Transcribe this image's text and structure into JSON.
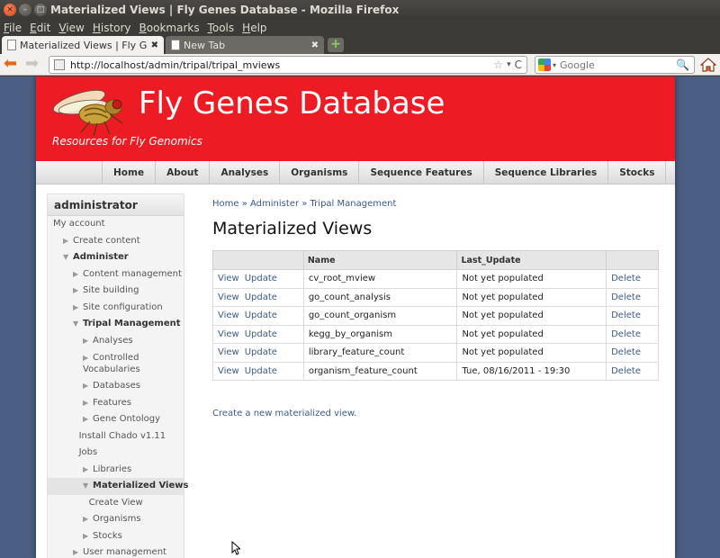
{
  "window": {
    "title": "Materialized Views | Fly Genes Database - Mozilla Firefox",
    "controls": {
      "close": "×",
      "minimize": "–",
      "maximize": "□"
    }
  },
  "menubar": [
    "File",
    "Edit",
    "View",
    "History",
    "Bookmarks",
    "Tools",
    "Help"
  ],
  "tabs": [
    {
      "label": "Materialized Views | Fly Ge...",
      "active": true,
      "close": "✖"
    },
    {
      "label": "New Tab",
      "active": false,
      "close": "✖"
    }
  ],
  "newtab_label": "+",
  "navbar": {
    "back": "⬅",
    "forward": "➡",
    "url": "http://localhost/admin/tripal/tripal_mviews",
    "search_placeholder": "Google",
    "star": "☆",
    "dropdown": "▾",
    "reload": "C",
    "search_icon": "🔍"
  },
  "site": {
    "name": "Fly Genes Database",
    "slogan": "Resources for Fly Genomics",
    "header_color": "#ed1c24"
  },
  "primary_nav": [
    "Home",
    "About",
    "Analyses",
    "Organisms",
    "Sequence Features",
    "Sequence Libraries",
    "Stocks"
  ],
  "sidebar": {
    "title": "administrator",
    "items": [
      {
        "label": "My account",
        "indent": 0,
        "arrow": "",
        "bold": false
      },
      {
        "label": "Create content",
        "indent": 1,
        "arrow": "▶",
        "bold": false
      },
      {
        "label": "Administer",
        "indent": 1,
        "arrow": "▼",
        "bold": true
      },
      {
        "label": "Content management",
        "indent": 2,
        "arrow": "▶",
        "bold": false
      },
      {
        "label": "Site building",
        "indent": 2,
        "arrow": "▶",
        "bold": false
      },
      {
        "label": "Site configuration",
        "indent": 2,
        "arrow": "▶",
        "bold": false
      },
      {
        "label": "Tripal Management",
        "indent": 2,
        "arrow": "▼",
        "bold": true
      },
      {
        "label": "Analyses",
        "indent": 3,
        "arrow": "▶",
        "bold": false
      },
      {
        "label": "Controlled Vocabularies",
        "indent": 3,
        "arrow": "▶",
        "bold": false,
        "wrap": true
      },
      {
        "label": "Databases",
        "indent": 3,
        "arrow": "▶",
        "bold": false
      },
      {
        "label": "Features",
        "indent": 3,
        "arrow": "▶",
        "bold": false
      },
      {
        "label": "Gene Ontology",
        "indent": 3,
        "arrow": "▶",
        "bold": false
      },
      {
        "label": "Install Chado v1.11",
        "indent": 2.6,
        "arrow": "",
        "bold": false
      },
      {
        "label": "Jobs",
        "indent": 2.6,
        "arrow": "",
        "bold": false
      },
      {
        "label": "Libraries",
        "indent": 3,
        "arrow": "▶",
        "bold": false
      },
      {
        "label": "Materialized Views",
        "indent": 3,
        "arrow": "▼",
        "bold": true,
        "active": true
      },
      {
        "label": "Create View",
        "indent": 3.6,
        "arrow": "",
        "bold": false
      },
      {
        "label": "Organisms",
        "indent": 3,
        "arrow": "▶",
        "bold": false
      },
      {
        "label": "Stocks",
        "indent": 3,
        "arrow": "▶",
        "bold": false
      },
      {
        "label": "User management",
        "indent": 2,
        "arrow": "▶",
        "bold": false
      }
    ]
  },
  "breadcrumb": [
    "Home",
    "Administer",
    "Tripal Management"
  ],
  "breadcrumb_sep": " » ",
  "main": {
    "title": "Materialized Views",
    "table": {
      "headers": [
        "",
        "Name",
        "Last_Update",
        ""
      ],
      "rows": [
        {
          "view": "View",
          "update": "Update",
          "name": "cv_root_mview",
          "last_update": "Not yet populated",
          "delete": "Delete"
        },
        {
          "view": "View",
          "update": "Update",
          "name": "go_count_analysis",
          "last_update": "Not yet populated",
          "delete": "Delete"
        },
        {
          "view": "View",
          "update": "Update",
          "name": "go_count_organism",
          "last_update": "Not yet populated",
          "delete": "Delete"
        },
        {
          "view": "View",
          "update": "Update",
          "name": "kegg_by_organism",
          "last_update": "Not yet populated",
          "delete": "Delete"
        },
        {
          "view": "View",
          "update": "Update",
          "name": "library_feature_count",
          "last_update": "Not yet populated",
          "delete": "Delete"
        },
        {
          "view": "View",
          "update": "Update",
          "name": "organism_feature_count",
          "last_update": "Tue, 08/16/2011 - 19:30",
          "delete": "Delete"
        }
      ]
    },
    "create_link": "Create a new materialized view."
  }
}
